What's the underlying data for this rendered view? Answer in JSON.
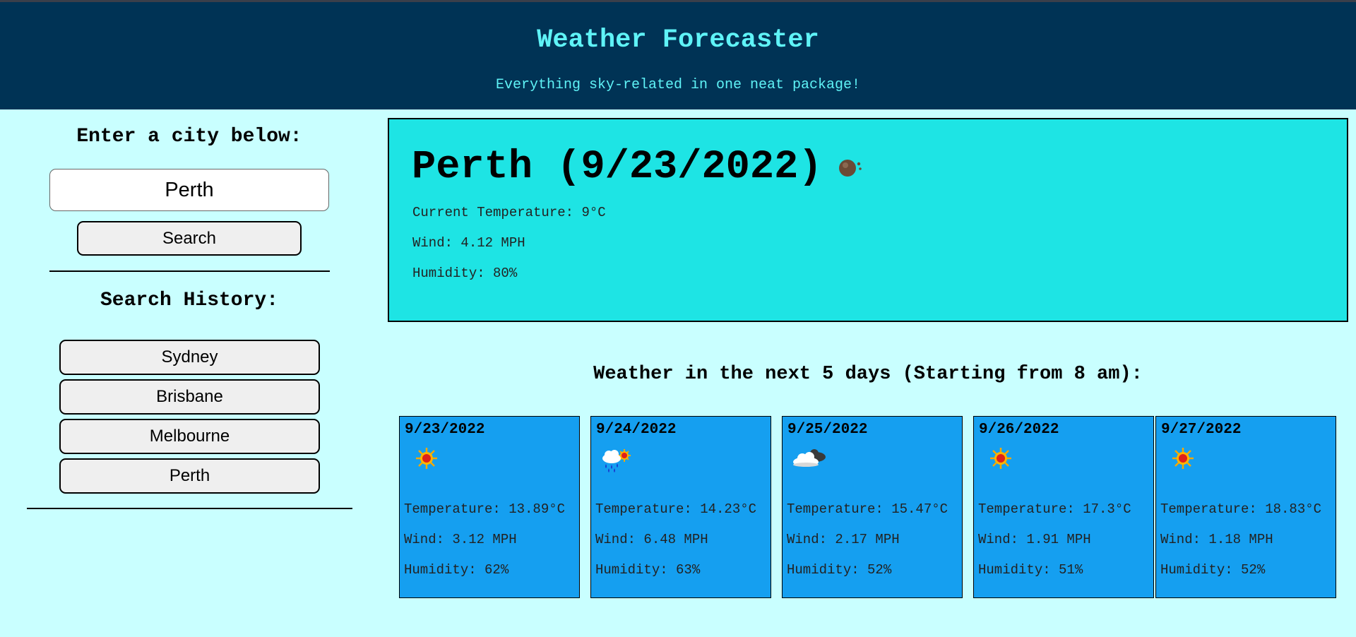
{
  "header": {
    "title": "Weather Forecaster",
    "subtitle": "Everything sky-related in one neat package!"
  },
  "sidebar": {
    "enter_label": "Enter a city below:",
    "city_input_value": "Perth",
    "search_label": "Search",
    "history_label": "Search History:",
    "history": [
      "Sydney",
      "Brisbane",
      "Melbourne",
      "Perth"
    ]
  },
  "current": {
    "heading": "Perth (9/23/2022)",
    "icon": "haze-icon",
    "temperature": "Current Temperature: 9°C",
    "wind": "Wind: 4.12 MPH",
    "humidity": "Humidity: 80%"
  },
  "forecast": {
    "heading": "Weather in the next 5 days (Starting from 8 am):",
    "days": [
      {
        "date": "9/23/2022",
        "icon": "sun-icon",
        "temperature": "Temperature: 13.89°C",
        "wind": "Wind: 3.12 MPH",
        "humidity": "Humidity: 62%"
      },
      {
        "date": "9/24/2022",
        "icon": "rain-sun-icon",
        "temperature": "Temperature: 14.23°C",
        "wind": "Wind: 6.48 MPH",
        "humidity": "Humidity: 63%"
      },
      {
        "date": "9/25/2022",
        "icon": "cloud-icon",
        "temperature": "Temperature: 15.47°C",
        "wind": "Wind: 2.17 MPH",
        "humidity": "Humidity: 52%"
      },
      {
        "date": "9/26/2022",
        "icon": "sun-icon",
        "temperature": "Temperature: 17.3°C",
        "wind": "Wind: 1.91 MPH",
        "humidity": "Humidity: 51%"
      },
      {
        "date": "9/27/2022",
        "icon": "sun-icon",
        "temperature": "Temperature: 18.83°C",
        "wind": "Wind: 1.18 MPH",
        "humidity": "Humidity: 52%"
      }
    ]
  },
  "colors": {
    "page_background": "#c9ffff",
    "header_background": "#003355",
    "title_color": "#5ff3f7",
    "current_card": "#1ee4e4",
    "forecast_card": "#159ff0"
  }
}
